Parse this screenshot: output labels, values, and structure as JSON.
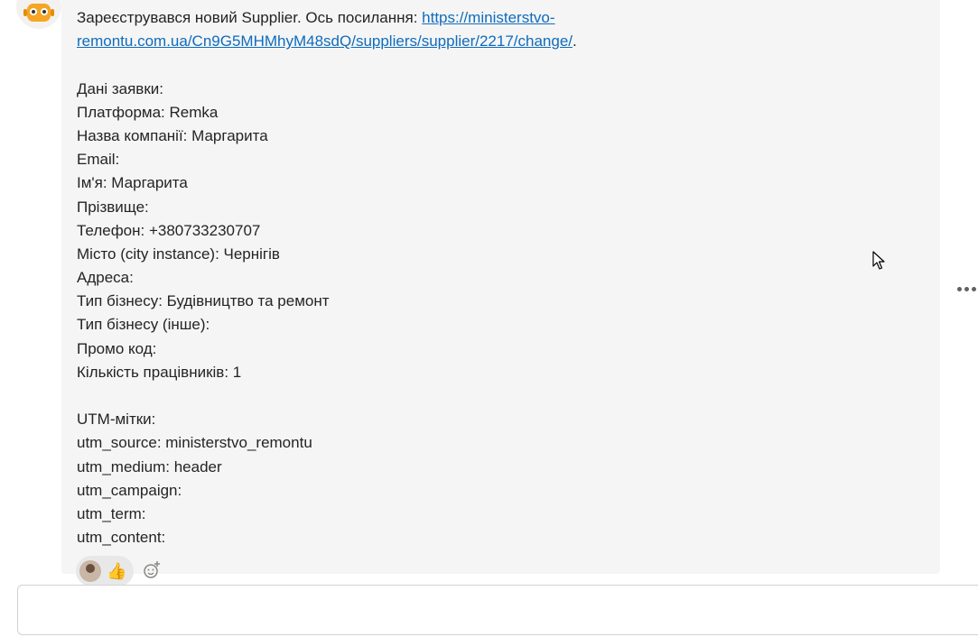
{
  "message": {
    "intro_text": "Зареєструвався новий Supplier. Ось посилання: ",
    "link_line1": "https://ministerstvo-",
    "link_line2": "remontu.com.ua/Cn9G5MHMhyM48sdQ/suppliers/supplier/2217/change/",
    "link_suffix": ".",
    "details_header": "Дані заявки:",
    "fields": [
      "Платформа: Remka",
      "Назва компанії: Маргарита",
      "Email:",
      "Ім'я: Маргарита",
      "Прізвище:",
      "Телефон: +380733230707",
      "Місто (city instance): Чернігів",
      "Адреса:",
      "Тип бізнесу: Будівництво та ремонт",
      "Тип бізнесу (інше):",
      "Промо код:",
      "Кількість працівників: 1"
    ],
    "utm_header": "UTM-мітки:",
    "utm": [
      "utm_source: ministerstvo_remontu",
      "utm_medium: header",
      "utm_campaign:",
      "utm_term:",
      "utm_content:"
    ]
  },
  "reactions": {
    "emoji": "👍"
  },
  "compose": {
    "placeholder": ""
  },
  "icons": {
    "avatar": "robot-icon",
    "more": "more-options-icon",
    "add_reaction": "add-reaction-icon",
    "cursor": "mouse-cursor-icon"
  },
  "colors": {
    "bubble": "#f5f5f5",
    "link": "#0f6cbd",
    "text": "#242424"
  }
}
